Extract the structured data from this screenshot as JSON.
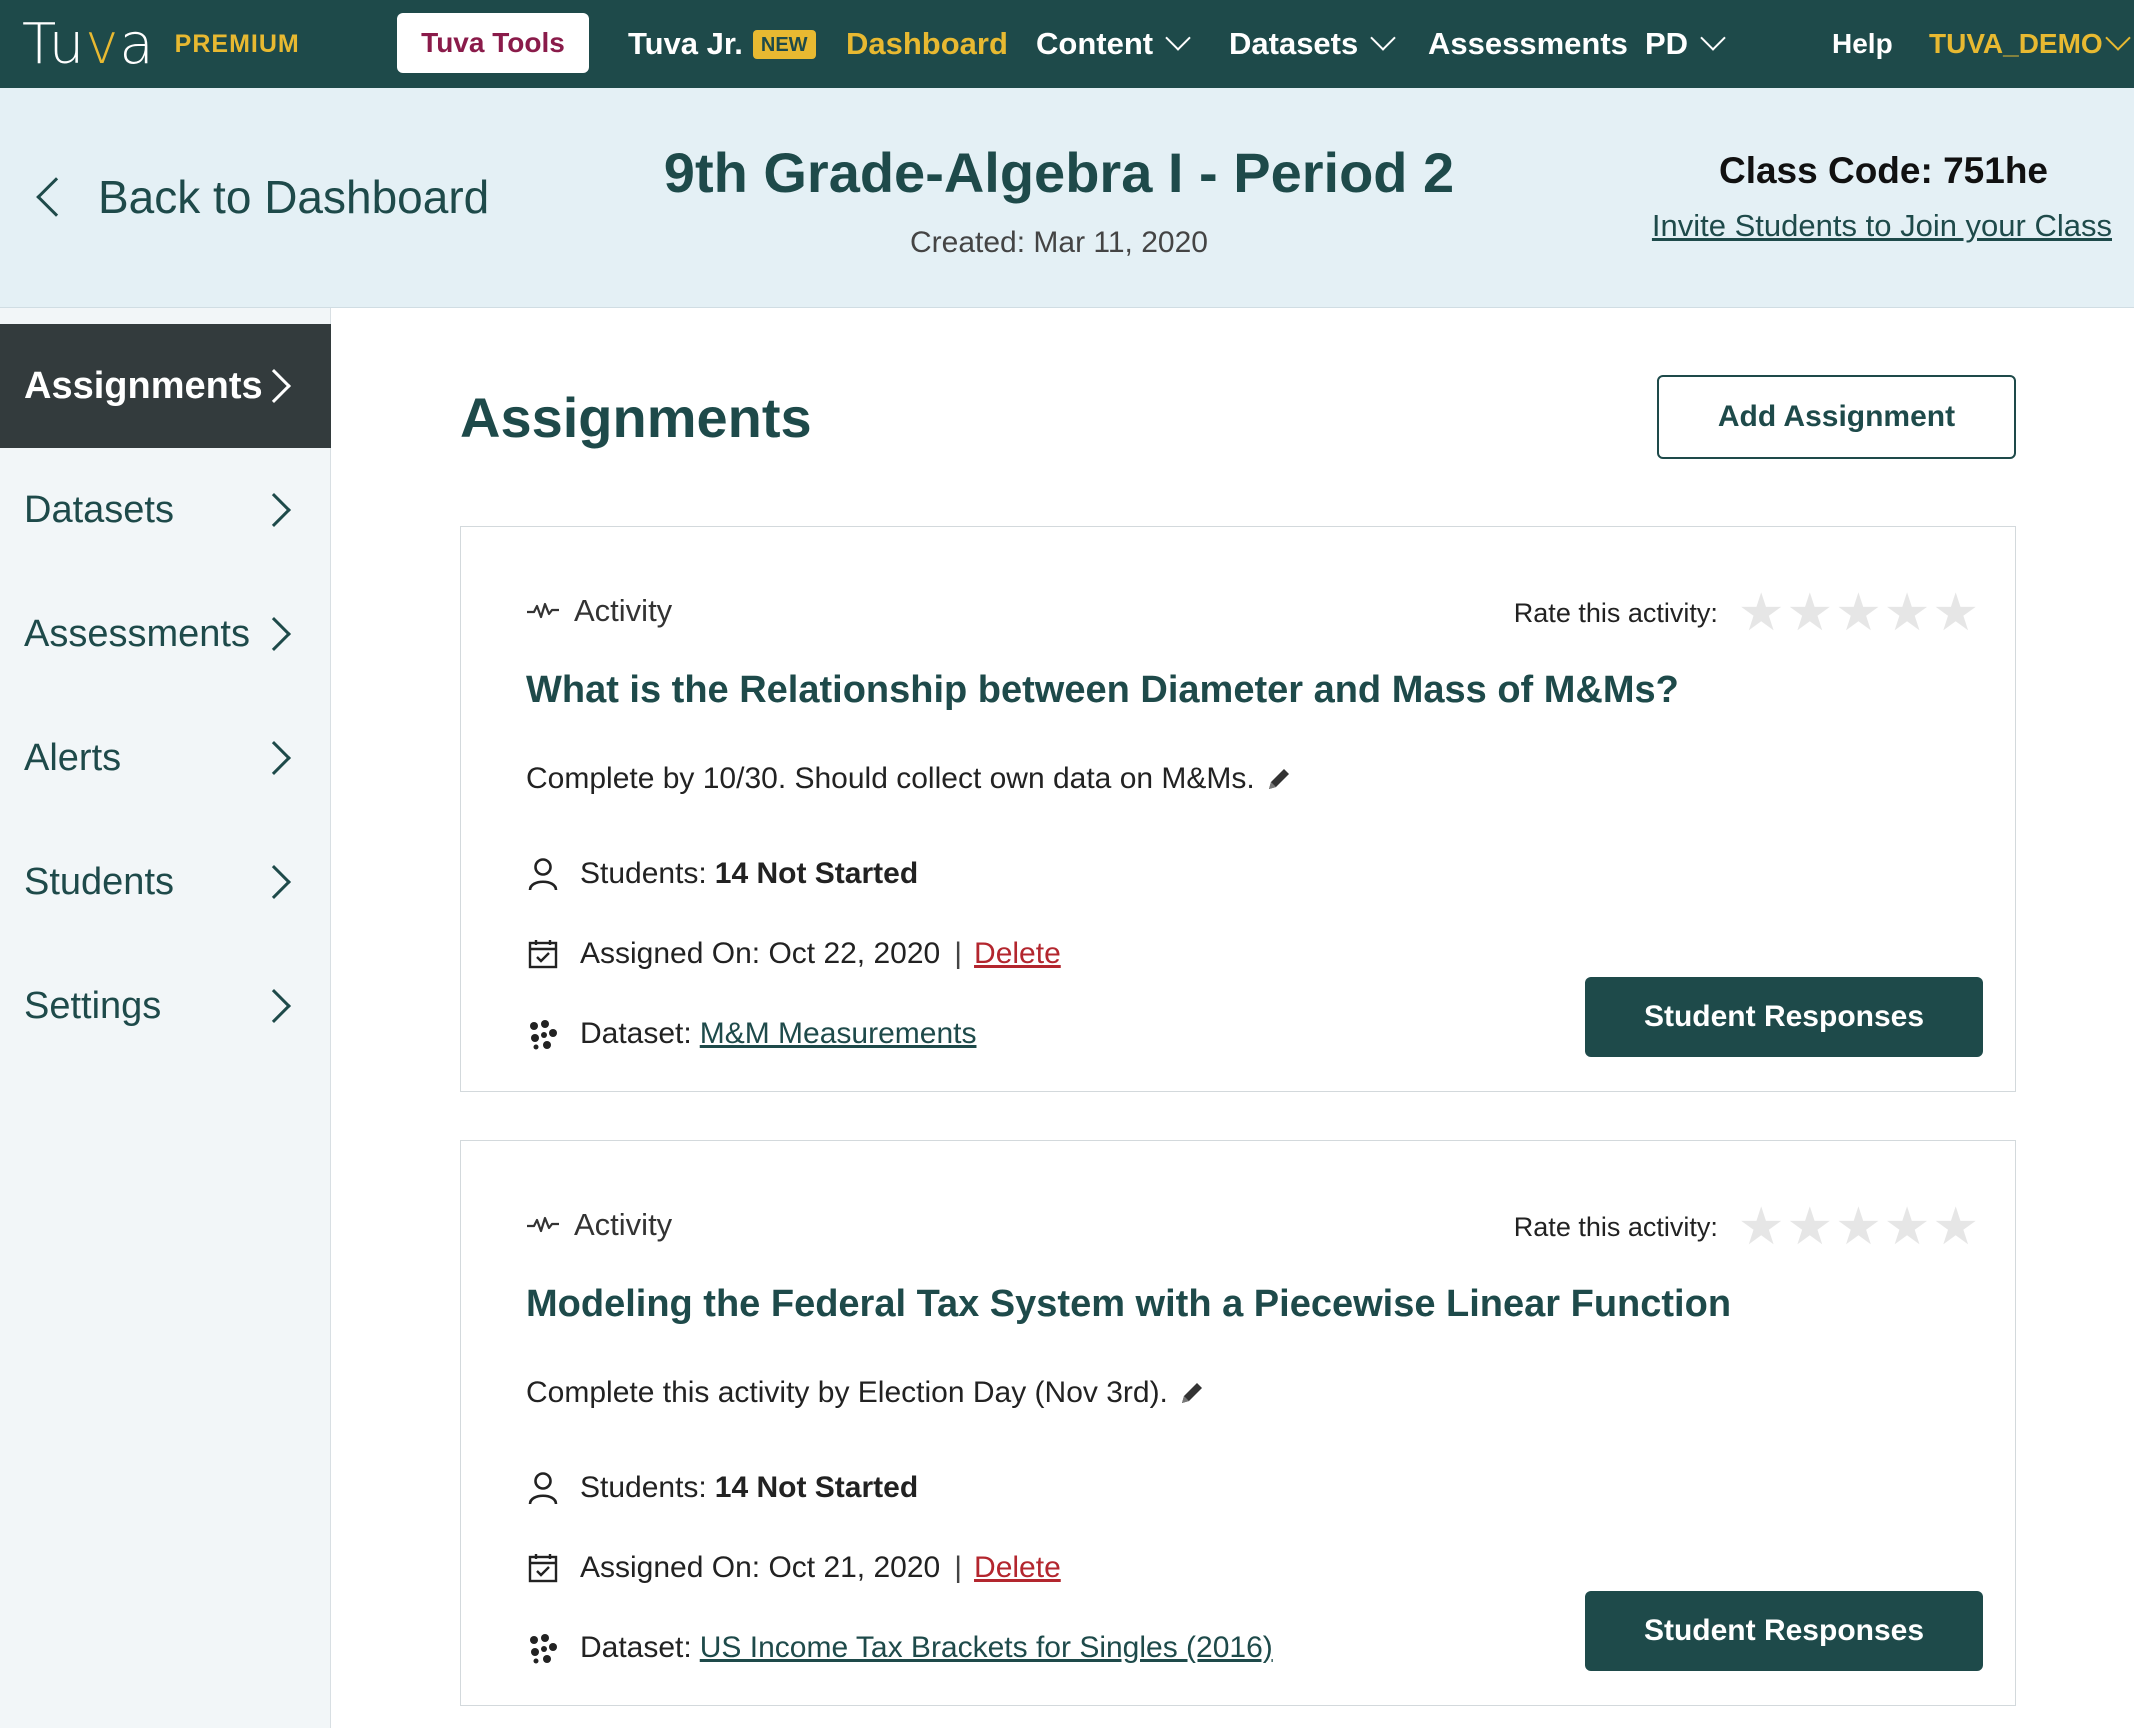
{
  "topnav": {
    "logo_text_a": "Tu",
    "logo_text_v": "v",
    "logo_text_b": "a",
    "premium": "PREMIUM",
    "tools": "Tuva Tools",
    "tuva_jr": "Tuva Jr.",
    "new_badge": "NEW",
    "dashboard": "Dashboard",
    "content": "Content",
    "datasets": "Datasets",
    "assessments": "Assessments",
    "pd": "PD",
    "help": "Help",
    "user": "TUVA_DEMO"
  },
  "header": {
    "back": "Back to Dashboard",
    "class_title": "9th Grade-Algebra I - Period 2",
    "created": "Created: Mar 11, 2020",
    "class_code": "Class Code: 751he",
    "invite": "Invite Students to Join your Class"
  },
  "sidebar": {
    "items": [
      {
        "label": "Assignments",
        "active": true
      },
      {
        "label": "Datasets"
      },
      {
        "label": "Assessments"
      },
      {
        "label": "Alerts"
      },
      {
        "label": "Students"
      },
      {
        "label": "Settings"
      }
    ]
  },
  "main": {
    "title": "Assignments",
    "add_button": "Add Assignment",
    "cards": [
      {
        "type": "Activity",
        "rate_label": "Rate this activity:",
        "rating": 0,
        "title": "What is the Relationship between Diameter and Mass of M&Ms?",
        "note": "Complete by 10/30. Should collect own data on M&Ms.",
        "students_label": "Students:",
        "students_value": "14 Not Started",
        "assigned_label": "Assigned On: Oct 22, 2020",
        "sep": "|",
        "delete": "Delete",
        "dataset_label": "Dataset:",
        "dataset_link": "M&M Measurements",
        "button": "Student Responses"
      },
      {
        "type": "Activity",
        "rate_label": "Rate this activity:",
        "rating": 0,
        "title": "Modeling the Federal Tax System with a Piecewise Linear Function",
        "note": "Complete this activity by Election Day (Nov 3rd).",
        "students_label": "Students:",
        "students_value": "14 Not Started",
        "assigned_label": "Assigned On: Oct 21, 2020",
        "sep": "|",
        "delete": "Delete",
        "dataset_label": "Dataset:",
        "dataset_link": "US Income Tax Brackets for Singles (2016)",
        "button": "Student Responses"
      }
    ]
  },
  "colors": {
    "brand_dark": "#1e4a4a",
    "brand_gold": "#e8b931",
    "header_bg": "#e4f0f5",
    "delete_red": "#b3262e",
    "tools_text": "#8a1b4a"
  }
}
